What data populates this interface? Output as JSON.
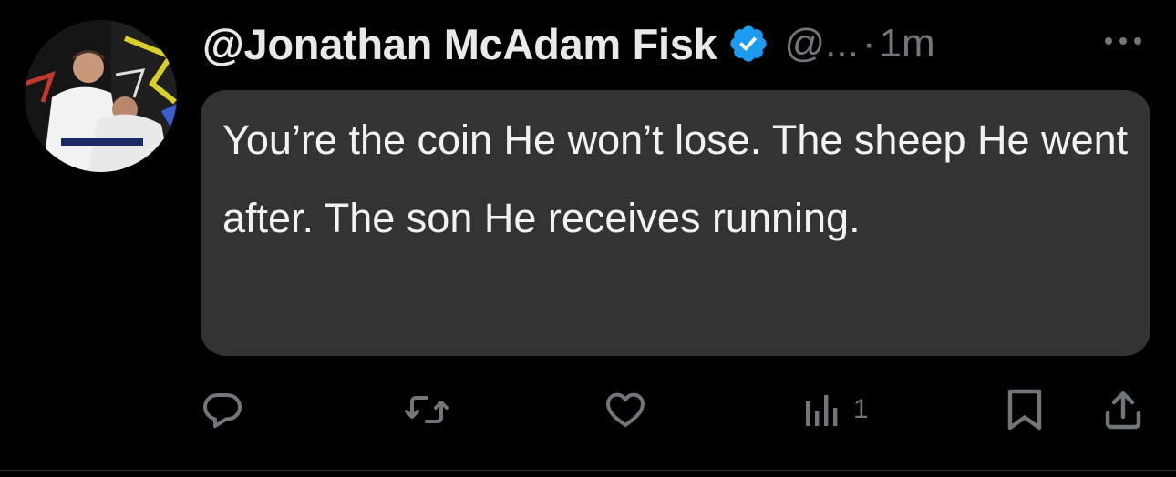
{
  "tweet": {
    "display_name": "@Jonathan McAdam Fisk",
    "handle": "@...",
    "separator": "·",
    "time": "1m",
    "text": "You’re the coin He won’t lose. The sheep He went after. The son He receives running.",
    "verified": true
  },
  "actions": {
    "reply_icon": "reply-icon",
    "retweet_icon": "retweet-icon",
    "like_icon": "heart-icon",
    "views_icon": "views-bar-chart-icon",
    "views_count": "1",
    "bookmark_icon": "bookmark-icon",
    "share_icon": "share-icon"
  },
  "colors": {
    "background": "#000000",
    "bubble": "#333333",
    "name": "#e7e9ea",
    "muted": "#71767b",
    "verified_badge": "#1d9bf0"
  }
}
